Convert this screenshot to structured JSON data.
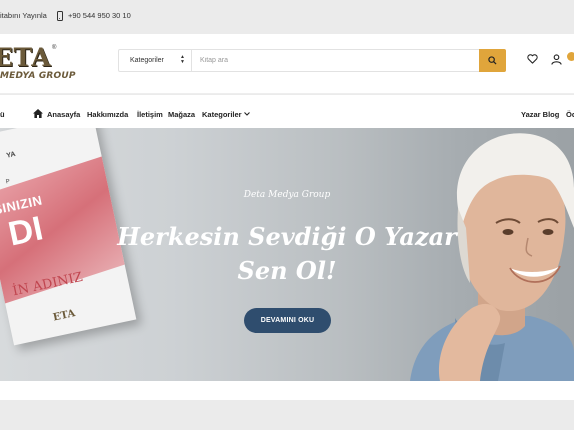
{
  "topbar": {
    "publish_text": "itabını Yayınla",
    "phone_icon": "phone-icon",
    "phone": "+90 544 950 30 10"
  },
  "logo": {
    "big": "ETA",
    "small": "MEDYA GROUP",
    "reg": "®"
  },
  "search": {
    "category_label": "Kategoriler",
    "placeholder": "Kitap ara",
    "value": "",
    "icon": "search-icon"
  },
  "header_icons": [
    "heart-icon",
    "user-icon",
    "cart-icon"
  ],
  "nav": {
    "left_cut": "ü",
    "home": "Anasayfa",
    "about": "Hakkımızda",
    "contact": "İletişim",
    "store": "Mağaza",
    "categories": "Kategoriler",
    "blog": "Yazar Blog",
    "right_cut": "Öd"
  },
  "hero": {
    "subtitle": "Deta Medya Group",
    "title_line1": "Herkesin Sevdiği O Yazar",
    "title_line2": "Sen Ol!",
    "cta": "DEVAMINI OKU"
  },
  "book": {
    "t1": "YA",
    "t2": "P",
    "t3": "SINIZIN",
    "t4": "DI",
    "t5": "İN ADINIZ",
    "t6": "ETA"
  },
  "colors": {
    "accent": "#e0a53b",
    "cta": "#2f4d6e",
    "brand": "#6b5a3a"
  }
}
